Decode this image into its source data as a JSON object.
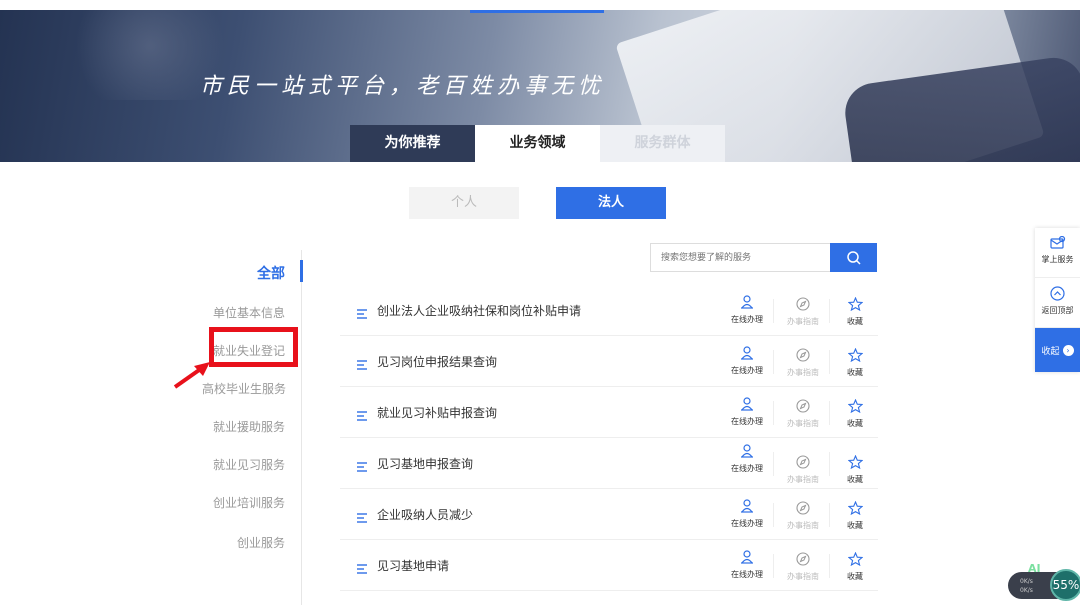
{
  "banner": {
    "slogan": "市民一站式平台，老百姓办事无忧"
  },
  "tabs": [
    "为你推荐",
    "业务领域",
    "服务群体"
  ],
  "toggles": {
    "person": "个人",
    "legal": "法人"
  },
  "menu": [
    "全部",
    "单位基本信息",
    "就业失业登记",
    "高校毕业生服务",
    "就业援助服务",
    "就业见习服务",
    "创业培训服务",
    "创业服务"
  ],
  "search": {
    "placeholder": "搜索您想要了解的服务"
  },
  "actions": {
    "online": "在线办理",
    "guide": "办事指南",
    "fav": "收藏"
  },
  "services": [
    {
      "title": "创业法人企业吸纳社保和岗位补贴申请"
    },
    {
      "title": "见习岗位申报结果查询"
    },
    {
      "title": "就业见习补贴申报查询"
    },
    {
      "title": "见习基地申报查询"
    },
    {
      "title": "企业吸纳人员减少"
    },
    {
      "title": "见习基地申请"
    }
  ],
  "sidebar": {
    "mobile": "掌上服务",
    "back_top": "返回顶部",
    "collapse": "收起"
  },
  "widget": {
    "ai": "AI",
    "up": "0K/s",
    "down": "0K/s",
    "percent": "55%"
  },
  "colors": {
    "accent": "#2f6fe5",
    "highlight": "#e8111b",
    "tab_dark": "#2f3b57"
  }
}
